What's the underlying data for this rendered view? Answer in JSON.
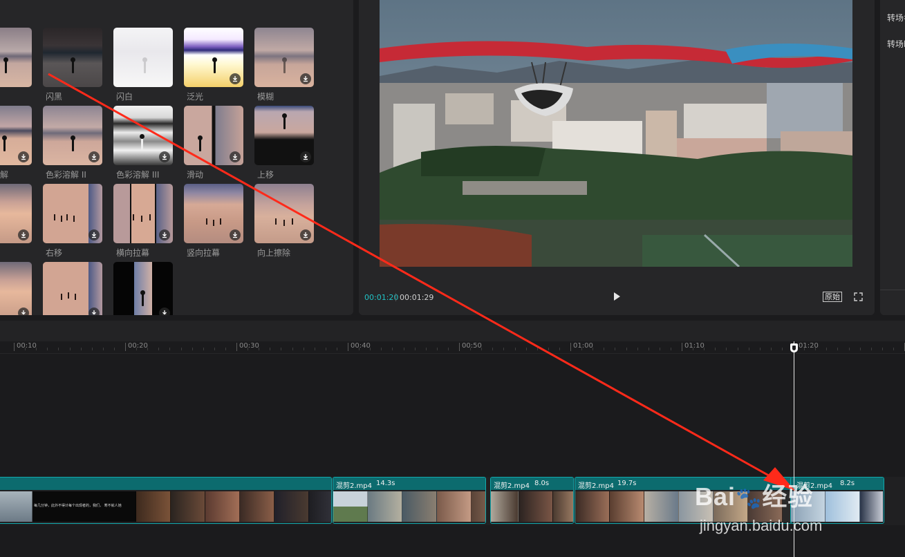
{
  "transitions": {
    "tiles": [
      {
        "label": "",
        "downloadable": false
      },
      {
        "label": "闪黑",
        "downloadable": false
      },
      {
        "label": "闪白",
        "downloadable": false
      },
      {
        "label": "泛光",
        "downloadable": true
      },
      {
        "label": "模糊",
        "downloadable": true
      },
      {
        "label": "解",
        "downloadable": true
      },
      {
        "label": "色彩溶解 II",
        "downloadable": true
      },
      {
        "label": "色彩溶解 III",
        "downloadable": true
      },
      {
        "label": "滑动",
        "downloadable": true
      },
      {
        "label": "上移",
        "downloadable": true
      },
      {
        "label": "",
        "downloadable": true
      },
      {
        "label": "右移",
        "downloadable": true
      },
      {
        "label": "横向拉幕",
        "downloadable": true
      },
      {
        "label": "竖向拉幕",
        "downloadable": true
      },
      {
        "label": "向上擦除",
        "downloadable": true
      },
      {
        "label": "",
        "downloadable": true
      },
      {
        "label": "",
        "downloadable": true
      },
      {
        "label": "",
        "downloadable": true
      }
    ]
  },
  "player": {
    "current_time": "00:01:20",
    "total_time": "00:01:29",
    "ratio_label": "原始",
    "play_icon": "play-icon",
    "fullscreen_icon": "fullscreen-icon"
  },
  "attributes": {
    "labels": [
      "转场名",
      "转场时"
    ]
  },
  "timeline": {
    "ruler_labels": [
      "00:10",
      "00:20",
      "00:30",
      "00:40",
      "00:50",
      "01:00",
      "01:10",
      "01:20"
    ],
    "playhead_time": "01:20",
    "clips": [
      {
        "name": "",
        "duration": "",
        "caption": "每几分钟，此外不得计每个出现者的，我们，     寒不就人她"
      },
      {
        "name": "混剪2.mp4",
        "duration": "14.3s"
      },
      {
        "name": "混剪2.mp4",
        "duration": "8.0s"
      },
      {
        "name": "混剪2.mp4",
        "duration": "19.7s"
      },
      {
        "name": "混剪2.mp4",
        "duration": "8.2s"
      }
    ]
  },
  "annotation": {
    "arrow_color": "#ff2a1a"
  },
  "watermark": {
    "brand": "Bai",
    "brand_cn": "经验",
    "url": "jingyan.baidu.com"
  },
  "colors": {
    "accent": "#21c3c6",
    "clip_border": "#12a9ad",
    "clip_header": "#0c6b6e"
  }
}
